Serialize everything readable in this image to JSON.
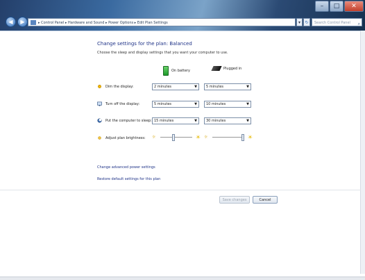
{
  "window": {
    "minimize": "–",
    "maximize": "□",
    "close": "✕"
  },
  "nav": {
    "back": "◀",
    "forward": "▶"
  },
  "address": {
    "path": "▸ Control Panel ▸ Hardware and Sound ▸ Power Options ▸ Edit Plan Settings",
    "dropdown": "▾",
    "refresh": "↻"
  },
  "search": {
    "placeholder": "Search Control Panel"
  },
  "page": {
    "title": "Change settings for the plan: Balanced",
    "subtitle": "Choose the sleep and display settings that you want your computer to use."
  },
  "columns": {
    "battery": "On battery",
    "plugged": "Plugged in"
  },
  "rows": [
    {
      "label": "Dim the display:",
      "battery": "2 minutes",
      "plugged": "5 minutes"
    },
    {
      "label": "Turn off the display:",
      "battery": "5 minutes",
      "plugged": "10 minutes"
    },
    {
      "label": "Put the computer to sleep:",
      "battery": "15 minutes",
      "plugged": "30 minutes"
    },
    {
      "label": "Adjust plan brightness:"
    }
  ],
  "brightness": {
    "battery_level": 0.4,
    "plugged_level": 1.0
  },
  "links": {
    "advanced": "Change advanced power settings",
    "restore": "Restore default settings for this plan"
  },
  "buttons": {
    "save": "Save changes",
    "cancel": "Cancel"
  },
  "colors": {
    "title": "#1e3287",
    "link": "#1e3287"
  }
}
